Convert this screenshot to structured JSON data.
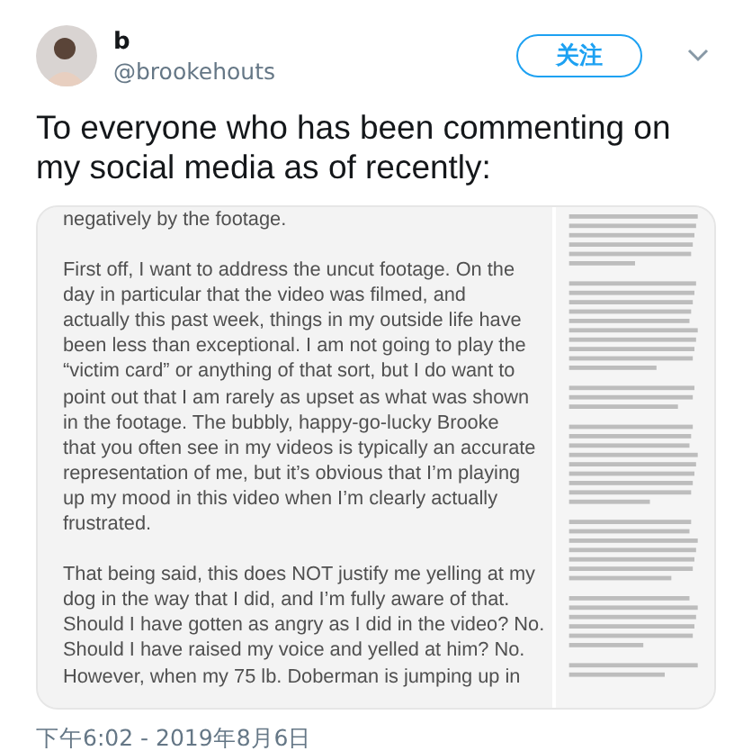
{
  "author": {
    "name": "b",
    "handle": "@brookehouts"
  },
  "follow_button": {
    "label": "关注"
  },
  "tweet_text": "To everyone who has been commenting on my social media as of recently:",
  "attached_document": {
    "paragraphs": [
      {
        "lines": [
          "negatively by the footage."
        ]
      },
      {
        "lines": [
          "First off, I want to address the uncut footage. On the",
          "day in particular that the video was filmed, and",
          "actually this past week, things in my outside life have",
          "been less than exceptional. I am not going to play the",
          "“victim card” or anything of that sort, but I do want to",
          "point out that I am rarely as upset as what was shown",
          "in the footage. The bubbly, happy-go-lucky Brooke",
          "that you often see in my videos is typically an accurate",
          "representation of me, but it’s obvious that I’m playing",
          "up my mood in this video when I’m clearly actually",
          "frustrated."
        ]
      },
      {
        "lines": [
          "That being said, this does NOT justify me yelling at my",
          "dog in the way that I did, and I’m fully aware of that.",
          "Should I have gotten as angry as I did in the video? No.",
          "Should I have raised my voice and yelled at him? No.",
          "However, when my 75 lb. Doberman is jumping up in"
        ]
      }
    ]
  },
  "timestamp": "下午6:02 - 2019年8月6日"
}
